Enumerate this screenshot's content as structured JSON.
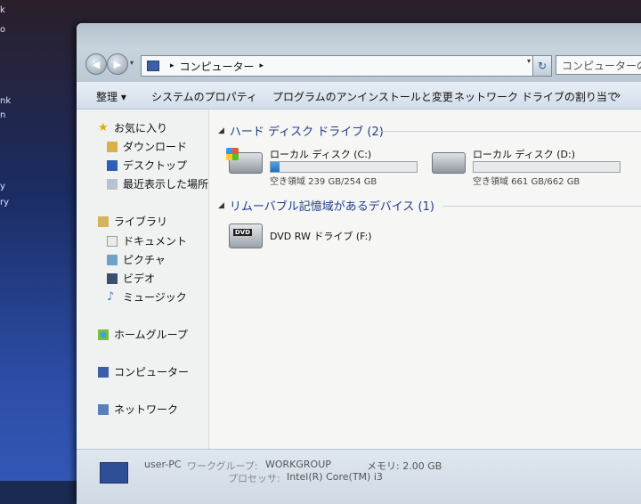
{
  "desktop": {
    "edge_texts": [
      "k",
      "o",
      "nk",
      "n",
      "y",
      "ry"
    ]
  },
  "window": {
    "address": {
      "root": "コンピューター",
      "sep_after": "▸"
    },
    "search_placeholder": "コンピューターの検",
    "toolbar": {
      "organize": "整理 ▾",
      "system_properties": "システムのプロパティ",
      "uninstall": "プログラムのアンインストールと変更",
      "map_drive": "ネットワーク ドライブの割り当て",
      "more": "»"
    },
    "sidebar": {
      "favorites": "お気に入り",
      "downloads": "ダウンロード",
      "desktop": "デスクトップ",
      "recent": "最近表示した場所",
      "libraries": "ライブラリ",
      "documents": "ドキュメント",
      "pictures": "ピクチャ",
      "videos": "ビデオ",
      "music": "ミュージック",
      "homegroup": "ホームグループ",
      "computer": "コンピューター",
      "network": "ネットワーク"
    },
    "groups": {
      "hdd": "ハード ディスク ドライブ (2)",
      "removable": "リムーバブル記憶域があるデバイス (1)"
    },
    "drives": {
      "c": {
        "name": "ローカル ディスク (C:)",
        "free": "空き領域 239 GB/254 GB",
        "used_fraction": 0.06
      },
      "d": {
        "name": "ローカル ディスク (D:)",
        "free": "空き領域 661 GB/662 GB",
        "used_fraction": 0.0
      },
      "dvd": {
        "name": "DVD RW ドライブ (F:)",
        "logo": "DVD"
      }
    },
    "details": {
      "pc_name": "user-PC",
      "workgroup_label": "ワークグループ:",
      "workgroup": "WORKGROUP",
      "memory": "メモリ: 2.00 GB",
      "processor_label": "プロセッサ:",
      "processor": "Intel(R) Core(TM) i3"
    }
  }
}
